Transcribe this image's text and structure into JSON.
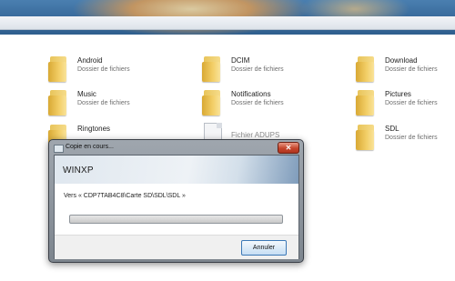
{
  "folders": [
    {
      "name": "Android",
      "type": "Dossier de fichiers",
      "icon": "folder-icon"
    },
    {
      "name": "DCIM",
      "type": "Dossier de fichiers",
      "icon": "folder-icon"
    },
    {
      "name": "Download",
      "type": "Dossier de fichiers",
      "icon": "folder-icon"
    },
    {
      "name": "Music",
      "type": "Dossier de fichiers",
      "icon": "folder-icon"
    },
    {
      "name": "Notifications",
      "type": "Dossier de fichiers",
      "icon": "folder-icon"
    },
    {
      "name": "Pictures",
      "type": "Dossier de fichiers",
      "icon": "folder-icon"
    },
    {
      "name": "Ringtones",
      "type": "",
      "icon": "folder-icon"
    },
    {
      "name": "Fichier ADUPS",
      "type": "",
      "icon": "file-icon"
    },
    {
      "name": "SDL",
      "type": "Dossier de fichiers",
      "icon": "folder-icon"
    }
  ],
  "dialog": {
    "title": "Copie en cours...",
    "close_label": "✕",
    "header_label": "WINXP",
    "destination": "Vers « CDP7TAB4C8\\Carte SD\\SDL\\SDL »",
    "progress": 0,
    "cancel_label": "Annuler"
  }
}
